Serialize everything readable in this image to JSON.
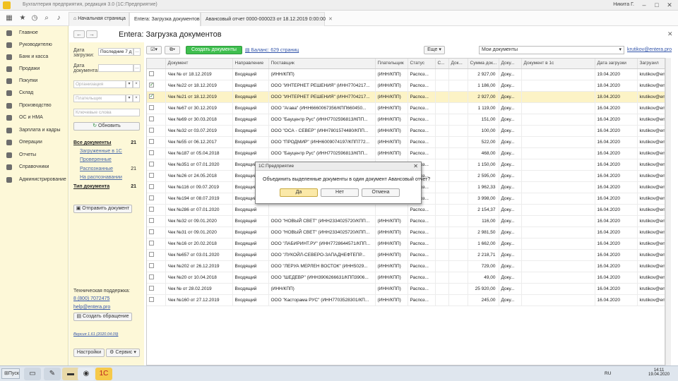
{
  "window": {
    "title": "Бухгалтерия предприятия, редакция 3.0 (1С:Предприятие)",
    "user": "Никита Г."
  },
  "tabs": [
    {
      "label": "Начальная страница"
    },
    {
      "label": "Entera: Загрузка документов"
    },
    {
      "label": "Авансовый отчет 0000-000023 от 18.12.2019 0:00:00"
    }
  ],
  "sidebar": {
    "items": [
      {
        "label": "Главное",
        "icon": "menu-icon"
      },
      {
        "label": "Руководителю",
        "icon": "chart-icon"
      },
      {
        "label": "Банк и касса",
        "icon": "bank-icon"
      },
      {
        "label": "Продажи",
        "icon": "sales-icon"
      },
      {
        "label": "Покупки",
        "icon": "cart-icon"
      },
      {
        "label": "Склад",
        "icon": "warehouse-icon"
      },
      {
        "label": "Производство",
        "icon": "factory-icon"
      },
      {
        "label": "ОС и НМА",
        "icon": "assets-icon"
      },
      {
        "label": "Зарплата и кадры",
        "icon": "people-icon"
      },
      {
        "label": "Операции",
        "icon": "operations-icon"
      },
      {
        "label": "Отчеты",
        "icon": "reports-icon"
      },
      {
        "label": "Справочники",
        "icon": "book-icon"
      },
      {
        "label": "Администрирование",
        "icon": "gear-icon"
      }
    ]
  },
  "page": {
    "title": "Entera: Загрузка документов"
  },
  "filter": {
    "date_label": "Дата загрузки:",
    "date_value": "Последние 7 д",
    "doc_date_label": "Дата документа:",
    "org_placeholder": "Организация",
    "payer_placeholder": "Плательщик",
    "keywords_placeholder": "Ключевые слова",
    "refresh": "Обновить",
    "categories": [
      {
        "label": "Все документы",
        "count": "21",
        "bold": true
      },
      {
        "label": "Загруженные в 1С",
        "count": ""
      },
      {
        "label": "Проверенные",
        "count": ""
      },
      {
        "label": "Распознанные",
        "count": "21"
      },
      {
        "label": "На распознавании",
        "count": ""
      },
      {
        "label": "Тип документа",
        "count": "21",
        "bold": true
      }
    ],
    "send_button": "Отправить документ",
    "support_label": "Техническая поддержка:",
    "support_phone": "8 (800) 7072475",
    "support_email": "help@entera.pro",
    "create_ticket": "Создать обращение",
    "version": "Версия 1.61 (2020.04.09)",
    "settings": "Настройки",
    "service": "Сервис"
  },
  "actions": {
    "create_docs": "Создать документы",
    "balance": "Баланс: 629 страниц",
    "more": "Еще",
    "my_docs": "Мои документы",
    "email": "krutikov@entera.pro"
  },
  "table": {
    "headers": [
      "",
      "Документ",
      "Направление",
      "Поставщик",
      "Плательщик",
      "Статус",
      "С...",
      "Док...",
      "Сумма док...",
      "Доку...",
      "Документ в 1с",
      "Дата загрузки",
      "Загрузил"
    ],
    "rows": [
      {
        "checked": false,
        "doc": "Чек № от 18.12.2019",
        "dir": "Входящий",
        "supplier": "(ИНН/КПП)",
        "payer": "(ИНН/КПП)",
        "status": "Распоз...",
        "sum": "2 927,00",
        "d1c": "Доку...",
        "date": "19.04.2020",
        "user": "krutikov@entera...",
        "sel": false
      },
      {
        "checked": true,
        "doc": "Чек №22 от 18.12.2019",
        "dir": "Входящий",
        "supplier": "ООО \"ИНТЕРНЕТ РЕШЕНИЯ\" (ИНН7704217...",
        "payer": "(ИНН/КПП)",
        "status": "Распоз...",
        "sum": "1 186,00",
        "d1c": "Доку...",
        "date": "18.04.2020",
        "user": "krutikov@entera...",
        "sel": false
      },
      {
        "checked": true,
        "doc": "Чек №21 от 18.12.2019",
        "dir": "Входящий",
        "supplier": "ООО \"ИНТЕРНЕТ РЕШЕНИЯ\" (ИНН7704217...",
        "payer": "(ИНН/КПП)",
        "status": "Распоз...",
        "sum": "2 927,00",
        "d1c": "Доку...",
        "date": "18.04.2020",
        "user": "krutikov@entera...",
        "sel": true
      },
      {
        "checked": false,
        "doc": "Чек №67 от 30.12.2019",
        "dir": "Входящий",
        "supplier": "ООО \"Агава\" (ИНН6660067356/КПП660450...",
        "payer": "(ИНН/КПП)",
        "status": "Распоз...",
        "sum": "1 119,00",
        "d1c": "Доку...",
        "date": "16.04.2020",
        "user": "krutikov@entera...",
        "sel": false
      },
      {
        "checked": false,
        "doc": "Чек №69 от 30.03.2018",
        "dir": "Входящий",
        "supplier": "ООО \"Бауцентр Рус\" (ИНН7702596813/КПП...",
        "payer": "(ИНН/КПП)",
        "status": "Распоз...",
        "sum": "151,00",
        "d1c": "Доку...",
        "date": "16.04.2020",
        "user": "krutikov@entera...",
        "sel": false
      },
      {
        "checked": false,
        "doc": "Чек №32 от 03.07.2019",
        "dir": "Входящий",
        "supplier": "ООО \"ОСА - СЕВЕР\" (ИНН7801574480/КПП...",
        "payer": "(ИНН/КПП)",
        "status": "Распоз...",
        "sum": "100,00",
        "d1c": "Доку...",
        "date": "16.04.2020",
        "user": "krutikov@entera...",
        "sel": false
      },
      {
        "checked": false,
        "doc": "Чек №55 от 06.12.2017",
        "dir": "Входящий",
        "supplier": "ООО \"ПРОДМИР\" (ИНН6009074197/КПП772...",
        "payer": "(ИНН/КПП)",
        "status": "Распоз...",
        "sum": "522,00",
        "d1c": "Доку...",
        "date": "16.04.2020",
        "user": "krutikov@entera...",
        "sel": false
      },
      {
        "checked": false,
        "doc": "Чек №187 от 05.04.2018",
        "dir": "Входящий",
        "supplier": "ООО \"Бауцентр Рус\" (ИНН7702596813/КПП...",
        "payer": "(ИНН/КПП)",
        "status": "Распоз...",
        "sum": "468,00",
        "d1c": "Доку...",
        "date": "16.04.2020",
        "user": "krutikov@entera...",
        "sel": false
      },
      {
        "checked": false,
        "doc": "Чек №351 от 07.01.2020",
        "dir": "Входящий",
        "supplier": "ООО \"ОССП\" (ИНН7703744400/КПП7703010...",
        "payer": "(ИНН/КПП)",
        "status": "Распоз...",
        "sum": "1 150,00",
        "d1c": "Доку...",
        "date": "16.04.2020",
        "user": "krutikov@entera...",
        "sel": false
      },
      {
        "checked": false,
        "doc": "Чек №26 от 24.05.2018",
        "dir": "Входящий",
        "supplier": "",
        "payer": "",
        "status": "Распоз...",
        "sum": "2 595,00",
        "d1c": "Доку...",
        "date": "16.04.2020",
        "user": "krutikov@entera...",
        "sel": false
      },
      {
        "checked": false,
        "doc": "Чек №116 от 09.07.2019",
        "dir": "Входящий",
        "supplier": "",
        "payer": "",
        "status": "Распоз...",
        "sum": "1 962,33",
        "d1c": "Доку...",
        "date": "16.04.2020",
        "user": "krutikov@entera...",
        "sel": false
      },
      {
        "checked": false,
        "doc": "Чек №194 от 08.07.2019",
        "dir": "Входящий",
        "supplier": "",
        "payer": "",
        "status": "Распоз...",
        "sum": "3 998,00",
        "d1c": "Доку...",
        "date": "16.04.2020",
        "user": "krutikov@entera...",
        "sel": false
      },
      {
        "checked": false,
        "doc": "Чек №286 от 07.01.2020",
        "dir": "Входящий",
        "supplier": "",
        "payer": "",
        "status": "Распоз...",
        "sum": "2 154,37",
        "d1c": "Доку...",
        "date": "16.04.2020",
        "user": "krutikov@entera...",
        "sel": false
      },
      {
        "checked": false,
        "doc": "Чек №32 от 09.01.2020",
        "dir": "Входящий",
        "supplier": "ООО \"НОВЫЙ СВЕТ\" (ИНН2334025720/КПП...",
        "payer": "(ИНН/КПП)",
        "status": "Распоз...",
        "sum": "116,00",
        "d1c": "Доку...",
        "date": "16.04.2020",
        "user": "krutikov@entera...",
        "sel": false
      },
      {
        "checked": false,
        "doc": "Чек №31 от 09.01.2020",
        "dir": "Входящий",
        "supplier": "ООО \"НОВЫЙ СВЕТ\" (ИНН2334025720/КПП...",
        "payer": "(ИНН/КПП)",
        "status": "Распоз...",
        "sum": "2 981,50",
        "d1c": "Доку...",
        "date": "16.04.2020",
        "user": "krutikov@entera...",
        "sel": false
      },
      {
        "checked": false,
        "doc": "Чек №16 от 20.02.2018",
        "dir": "Входящий",
        "supplier": "ООО \"ЛАБИРИНТ.РУ\" (ИНН7728644571/КПП...",
        "payer": "(ИНН/КПП)",
        "status": "Распоз...",
        "sum": "1 662,00",
        "d1c": "Доку...",
        "date": "16.04.2020",
        "user": "krutikov@entera...",
        "sel": false
      },
      {
        "checked": false,
        "doc": "Чек №657 от 03.01.2020",
        "dir": "Входящий",
        "supplier": "ООО \"ЛУКОЙЛ-СЕВЕРО-ЗАПАДНЕФТЕПР...",
        "payer": "(ИНН/КПП)",
        "status": "Распоз...",
        "sum": "2 218,71",
        "d1c": "Доку...",
        "date": "16.04.2020",
        "user": "krutikov@entera...",
        "sel": false
      },
      {
        "checked": false,
        "doc": "Чек №202 от 26.12.2019",
        "dir": "Входящий",
        "supplier": "ООО \"ЛЕРУА МЕРЛЕН ВОСТОК\" (ИНН5029...",
        "payer": "(ИНН/КПП)",
        "status": "Распоз...",
        "sum": "729,00",
        "d1c": "Доку...",
        "date": "16.04.2020",
        "user": "krutikov@entera...",
        "sel": false
      },
      {
        "checked": false,
        "doc": "Чек №20 от 10.04.2018",
        "dir": "Входящий",
        "supplier": "ООО \"ШЕДЕВР\" (ИНН3906266631/КПП3906...",
        "payer": "(ИНН/КПП)",
        "status": "Распоз...",
        "sum": "49,00",
        "d1c": "Доку...",
        "date": "16.04.2020",
        "user": "krutikov@entera...",
        "sel": false
      },
      {
        "checked": false,
        "doc": "Чек № от 28.02.2019",
        "dir": "Входящий",
        "supplier": "(ИНН/КПП)",
        "payer": "(ИНН/КПП)",
        "status": "Распоз...",
        "sum": "25 920,00",
        "d1c": "Доку...",
        "date": "16.04.2020",
        "user": "krutikov@entera...",
        "sel": false
      },
      {
        "checked": false,
        "doc": "Чек №160 от 27.12.2019",
        "dir": "Входящий",
        "supplier": "ООО \"Касторама РУС\" (ИНН7703528301/КП...",
        "payer": "(ИНН/КПП)",
        "status": "Распоз...",
        "sum": "245,00",
        "d1c": "Доку...",
        "date": "16.04.2020",
        "user": "krutikov@entera...",
        "sel": false
      }
    ]
  },
  "dialog": {
    "title": "1С:Предприятие",
    "message": "Объединить выделенные документы в один документ Авансовый отчет?",
    "yes": "Да",
    "no": "Нет",
    "cancel": "Отмена"
  },
  "taskbar": {
    "start": "Пуск",
    "lang": "RU",
    "time": "14:11",
    "date": "19.04.2020"
  },
  "colors": {
    "sidebar_bg": "#fdf8d8",
    "accent_green": "#3fbf4f",
    "selected_row": "#fcf3c6"
  }
}
